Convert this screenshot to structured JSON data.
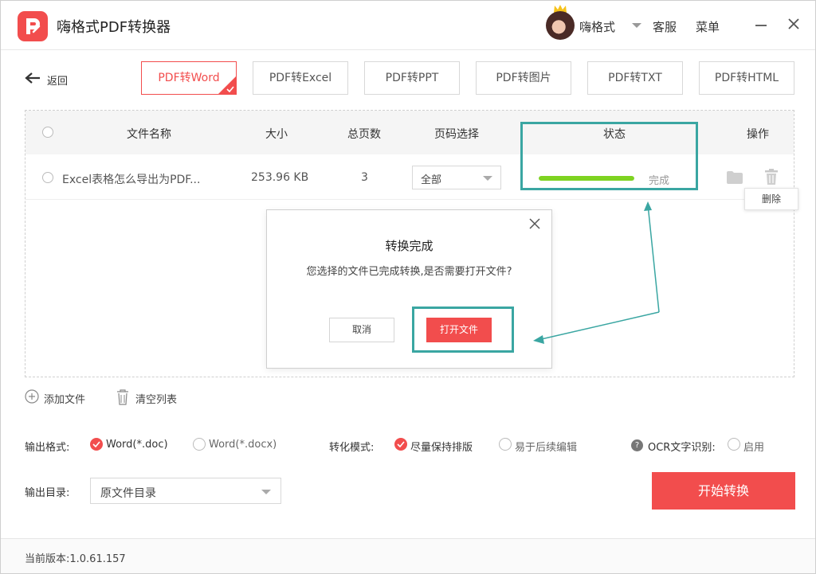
{
  "app": {
    "title": "嗨格式PDF转换器"
  },
  "header": {
    "user_name": "嗨格式",
    "service": "客服",
    "menu": "菜单"
  },
  "toolbar": {
    "back_label": "返回",
    "tabs": [
      {
        "label": "PDF转Word",
        "active": true
      },
      {
        "label": "PDF转Excel",
        "active": false
      },
      {
        "label": "PDF转PPT",
        "active": false
      },
      {
        "label": "PDF转图片",
        "active": false
      },
      {
        "label": "PDF转TXT",
        "active": false
      },
      {
        "label": "PDF转HTML",
        "active": false
      }
    ]
  },
  "table": {
    "headers": {
      "name": "文件名称",
      "size": "大小",
      "pages": "总页数",
      "page_select": "页码选择",
      "status": "状态",
      "action": "操作"
    },
    "rows": [
      {
        "name": "Excel表格怎么导出为PDF...",
        "size": "253.96 KB",
        "pages": "3",
        "page_select": "全部",
        "progress": 1.0,
        "status": "完成"
      }
    ],
    "delete_tooltip": "删除"
  },
  "dialog": {
    "title": "转换完成",
    "message": "您选择的文件已完成转换,是否需要打开文件?",
    "cancel_label": "取消",
    "open_label": "打开文件"
  },
  "actions": {
    "add_file": "添加文件",
    "clear_list": "清空列表"
  },
  "options": {
    "output_format_label": "输出格式:",
    "format_doc": "Word(*.doc)",
    "format_docx": "Word(*.docx)",
    "format_selected": "Word(*.doc)",
    "mode_label": "转化模式:",
    "mode_keep_layout": "尽量保持排版",
    "mode_easy_edit": "易于后续编辑",
    "mode_selected": "尽量保持排版",
    "ocr_label": "OCR文字识别:",
    "ocr_enable": "启用",
    "ocr_enabled": false,
    "output_dir_label": "输出目录:",
    "output_dir_value": "原文件目录"
  },
  "start_button": "开始转换",
  "footer": {
    "version": "当前版本:1.0.61.157"
  },
  "colors": {
    "accent": "#f24d4d",
    "highlight": "#3aa6a2",
    "progress": "#7ed321"
  }
}
